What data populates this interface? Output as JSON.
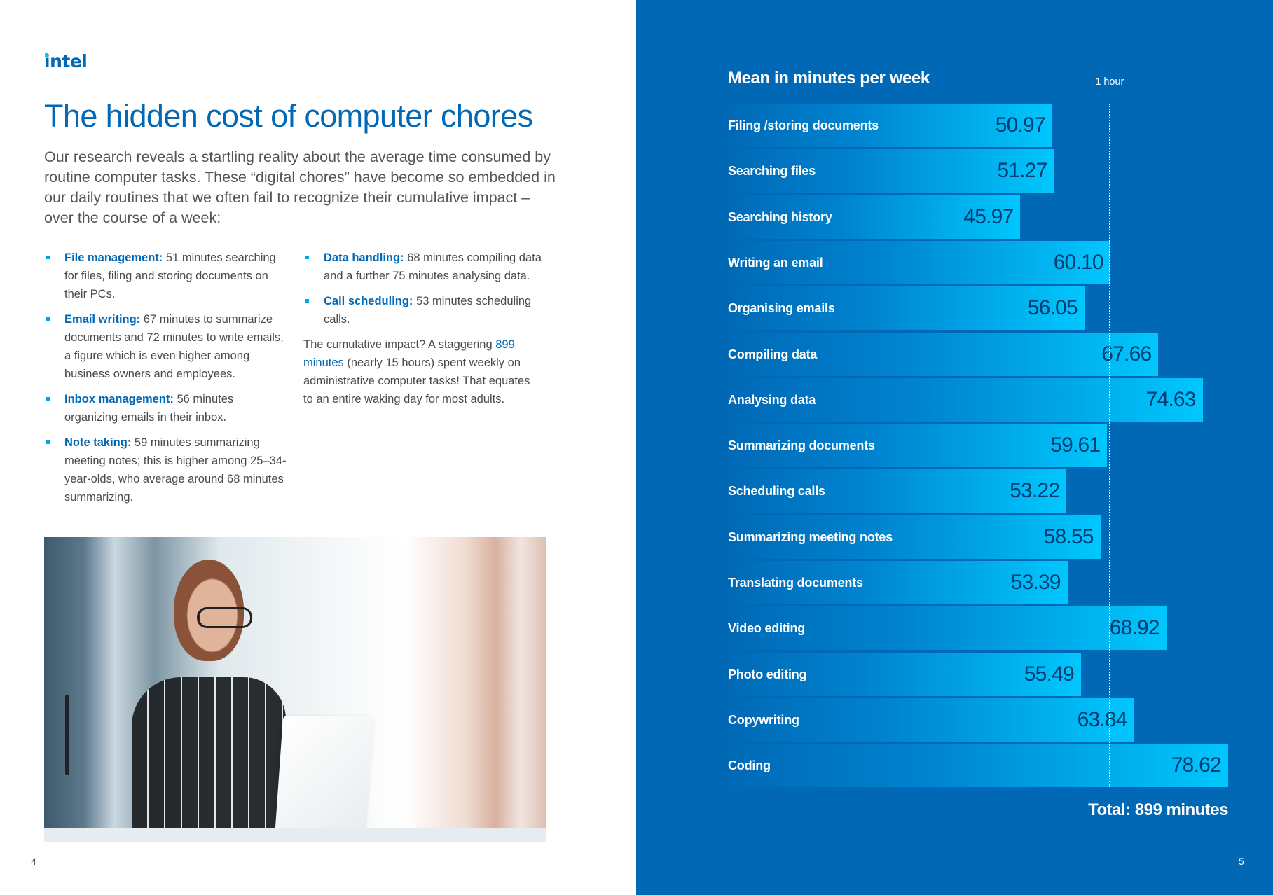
{
  "left_page": {
    "logo": "intel",
    "title": "The hidden cost of computer chores",
    "intro": "Our research reveals a startling reality about the average time consumed by routine computer tasks. These “digital chores” have become so embedded in our daily routines that we often fail to recognize their cumulative impact – over the course of a week:",
    "bullets_col1": [
      {
        "term": "File management:",
        "text": " 51 minutes searching for files, filing and storing documents on their PCs."
      },
      {
        "term": "Email writing:",
        "text": " 67 minutes to summarize documents and 72 minutes to write emails, a figure which is even higher among business owners and employees."
      },
      {
        "term": "Inbox management:",
        "text": " 56 minutes organizing emails in their inbox."
      },
      {
        "term": "Note taking:",
        "text": " 59 minutes summarizing meeting notes; this is higher among 25–34-year-olds, who average around 68 minutes summarizing."
      }
    ],
    "bullets_col2": [
      {
        "term": "Data handling:",
        "text": " 68 minutes compiling data and a further 75 minutes analysing data."
      },
      {
        "term": "Call scheduling:",
        "text": " 53 minutes scheduling calls."
      }
    ],
    "summary": {
      "before": "The cumulative impact? A staggering ",
      "highlight": "899 minutes",
      "after": " (nearly 15 hours) spent weekly on administrative computer tasks! That equates to an entire waking day for most adults."
    },
    "photo_alt": "Woman with glasses working on a laptop in an office",
    "page_number": "4"
  },
  "right_page": {
    "page_number": "5"
  },
  "colors": {
    "brand_blue": "#0068B5",
    "accent_cyan": "#00C7FD",
    "value_navy": "#003C71"
  },
  "chart_data": {
    "type": "bar",
    "orientation": "horizontal",
    "title": "Mean in minutes per week",
    "categories": [
      "Filing /storing documents",
      "Searching files",
      "Searching history",
      "Writing an email",
      "Organising emails",
      "Compiling data",
      "Analysing data",
      "Summarizing documents",
      "Scheduling calls",
      "Summarizing meeting notes",
      "Translating documents",
      "Video editing",
      "Photo editing",
      "Copywriting",
      "Coding"
    ],
    "values": [
      50.97,
      51.27,
      45.97,
      60.1,
      56.05,
      67.66,
      74.63,
      59.61,
      53.22,
      58.55,
      53.39,
      68.92,
      55.49,
      63.84,
      78.62
    ],
    "value_labels": [
      "50.97",
      "51.27",
      "45.97",
      "60.10",
      "56.05",
      "67.66",
      "74.63",
      "59.61",
      "53.22",
      "58.55",
      "53.39",
      "68.92",
      "55.49",
      "63.84",
      "78.62"
    ],
    "reference_line": {
      "value": 60,
      "label": "1 hour",
      "style": "dotted"
    },
    "xlabel": "",
    "ylabel": "",
    "xlim": [
      0,
      80
    ],
    "grid": false,
    "total_label": "Total: 899 minutes"
  }
}
